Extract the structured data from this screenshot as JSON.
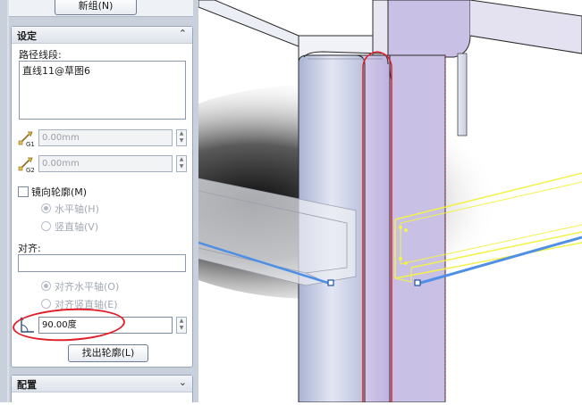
{
  "panel": {
    "new_group_button": "新组(N)",
    "settings": {
      "title": "设定",
      "collapse_icon": "double-chevron-up",
      "path_label": "路径线段:",
      "path_items": [
        "直线11@草图6"
      ],
      "g1_value": "0.00mm",
      "g2_value": "0.00mm",
      "mirror_profile": "镜向轮廓(M)",
      "horizontal_axis": "水平轴(H)",
      "vertical_axis": "竖直轴(V)",
      "align_label": "对齐:",
      "align_value": "",
      "align_horizontal": "对齐水平轴(O)",
      "align_vertical": "对齐竖直轴(E)",
      "angle_value": "90.00度",
      "find_profile_button": "找出轮廓(L)"
    },
    "config": {
      "title": "配置",
      "expand_icon": "double-chevron-down"
    }
  },
  "colors": {
    "panel_bg": "#c8d0dc",
    "highlight_ellipse": "#e0202a",
    "selection_yellow": "#f2f24a",
    "path_blue": "#4f8fe6",
    "leg_purple": "#c9c0e6"
  },
  "viewport": {
    "g_labels": [
      "G1",
      "G2"
    ]
  }
}
